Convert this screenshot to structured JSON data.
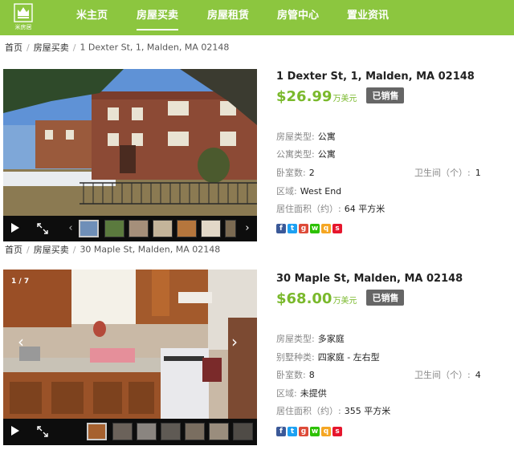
{
  "logo": {
    "text": "米房居"
  },
  "nav": {
    "items": [
      {
        "label": "米主页"
      },
      {
        "label": "房屋买卖"
      },
      {
        "label": "房屋租赁"
      },
      {
        "label": "房管中心"
      },
      {
        "label": "置业资讯"
      }
    ],
    "active": "房屋买卖"
  },
  "listings": [
    {
      "breadcrumb": [
        "首页",
        "房屋买卖",
        "1 Dexter St, 1, Malden, MA 02148"
      ],
      "title": "1 Dexter St, 1, Malden, MA 02148",
      "price": "$26.99",
      "price_unit": "万美元",
      "status": "已销售",
      "attributes": [
        {
          "key": "房屋类型:",
          "value": "公寓"
        },
        {
          "key": "公寓类型:",
          "value": "公寓"
        },
        {
          "key": "卧室数:",
          "value": "2"
        },
        {
          "key": "区域:",
          "value": "West End"
        },
        {
          "key": "居住面积（约）:",
          "value": "64 平方米"
        }
      ],
      "bathroom": {
        "key": "卫生间（个）:",
        "value": "1"
      }
    },
    {
      "breadcrumb": [
        "首页",
        "房屋买卖",
        "30 Maple St, Malden, MA 02148"
      ],
      "title": "30 Maple St, Malden, MA 02148",
      "price": "$68.00",
      "price_unit": "万美元",
      "status": "已销售",
      "photo_counter": "1 / 7",
      "attributes": [
        {
          "key": "房屋类型:",
          "value": "多家庭"
        },
        {
          "key": "别墅种类:",
          "value": "四家庭 - 左右型"
        },
        {
          "key": "卧室数:",
          "value": "8"
        },
        {
          "key": "区域:",
          "value": "未提供"
        },
        {
          "key": "居住面积（约）:",
          "value": "355 平方米"
        }
      ],
      "bathroom": {
        "key": "卫生间（个）:",
        "value": "4"
      }
    }
  ],
  "gallery_controls": {
    "play": "▶",
    "prev": "‹",
    "next": "›",
    "photo_prev": "‹",
    "photo_next": "›"
  },
  "share_icons": [
    {
      "name": "facebook-icon",
      "glyph": "f",
      "color": "#3b5998"
    },
    {
      "name": "twitter-icon",
      "glyph": "t",
      "color": "#1da1f2"
    },
    {
      "name": "google-plus-icon",
      "glyph": "g",
      "color": "#dd4b39"
    },
    {
      "name": "wechat-icon",
      "glyph": "w",
      "color": "#2dc100"
    },
    {
      "name": "qzone-icon",
      "glyph": "q",
      "color": "#f5a623"
    },
    {
      "name": "weibo-icon",
      "glyph": "s",
      "color": "#e6162d"
    }
  ],
  "colors": {
    "nav": "#8cc63f",
    "price": "#7ab92c",
    "badge": "#666666"
  }
}
